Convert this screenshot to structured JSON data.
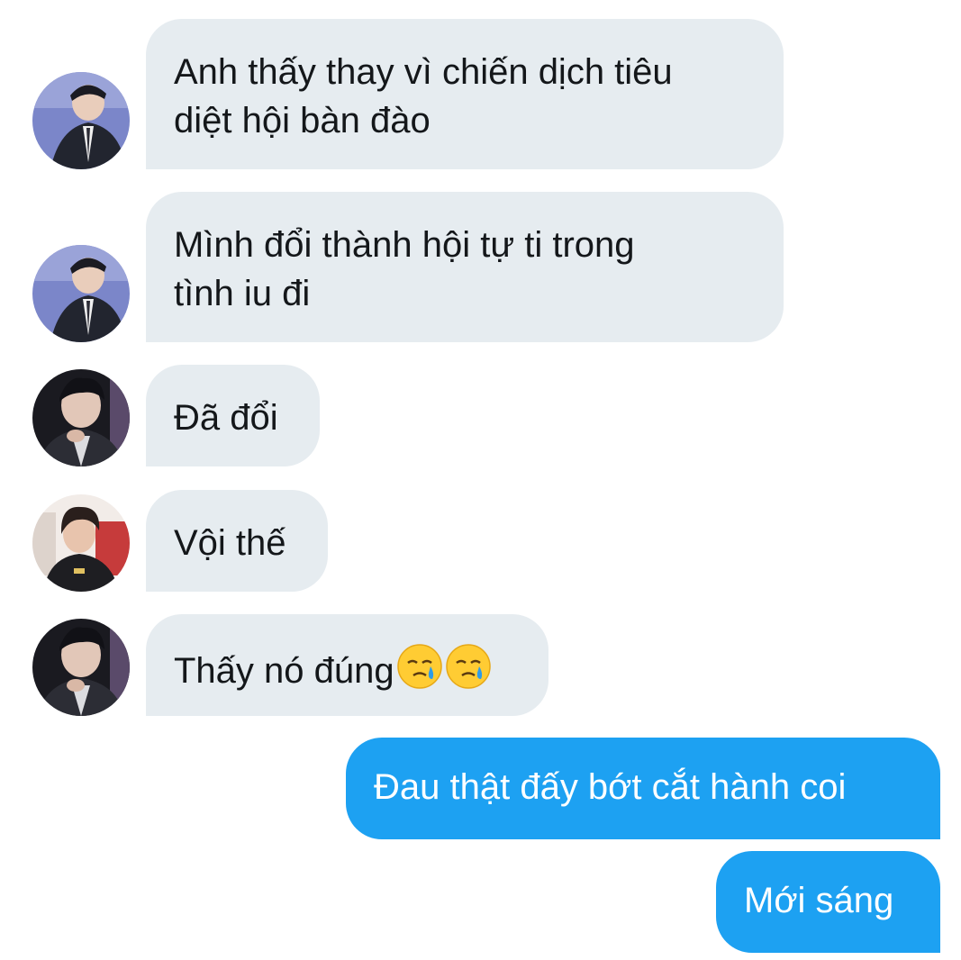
{
  "conversation": {
    "messages": [
      {
        "direction": "incoming",
        "sender_avatar": "avatar-a",
        "lines": [
          "Anh thấy thay vì chiến dịch tiêu",
          "diệt hội bàn đào"
        ]
      },
      {
        "direction": "incoming",
        "sender_avatar": "avatar-a",
        "lines": [
          "Mình đổi thành hội tự ti trong",
          "tình iu đi"
        ]
      },
      {
        "direction": "incoming",
        "sender_avatar": "avatar-b",
        "lines": [
          "Đã đổi"
        ]
      },
      {
        "direction": "incoming",
        "sender_avatar": "avatar-c",
        "lines": [
          "Vội thế"
        ]
      },
      {
        "direction": "incoming",
        "sender_avatar": "avatar-b",
        "lines": [
          "Thấy nó đúng"
        ],
        "emojis": [
          "face-holding-back-tears",
          "face-holding-back-tears"
        ]
      },
      {
        "direction": "outgoing",
        "lines": [
          "Đau thật đấy bớt cắt hành coi"
        ]
      },
      {
        "direction": "outgoing",
        "lines": [
          "Mới sáng"
        ]
      }
    ]
  },
  "colors": {
    "incoming_bubble": "#e6ecf0",
    "outgoing_bubble": "#1da1f2",
    "incoming_text": "#14171a",
    "outgoing_text": "#ffffff",
    "background": "#ffffff"
  }
}
